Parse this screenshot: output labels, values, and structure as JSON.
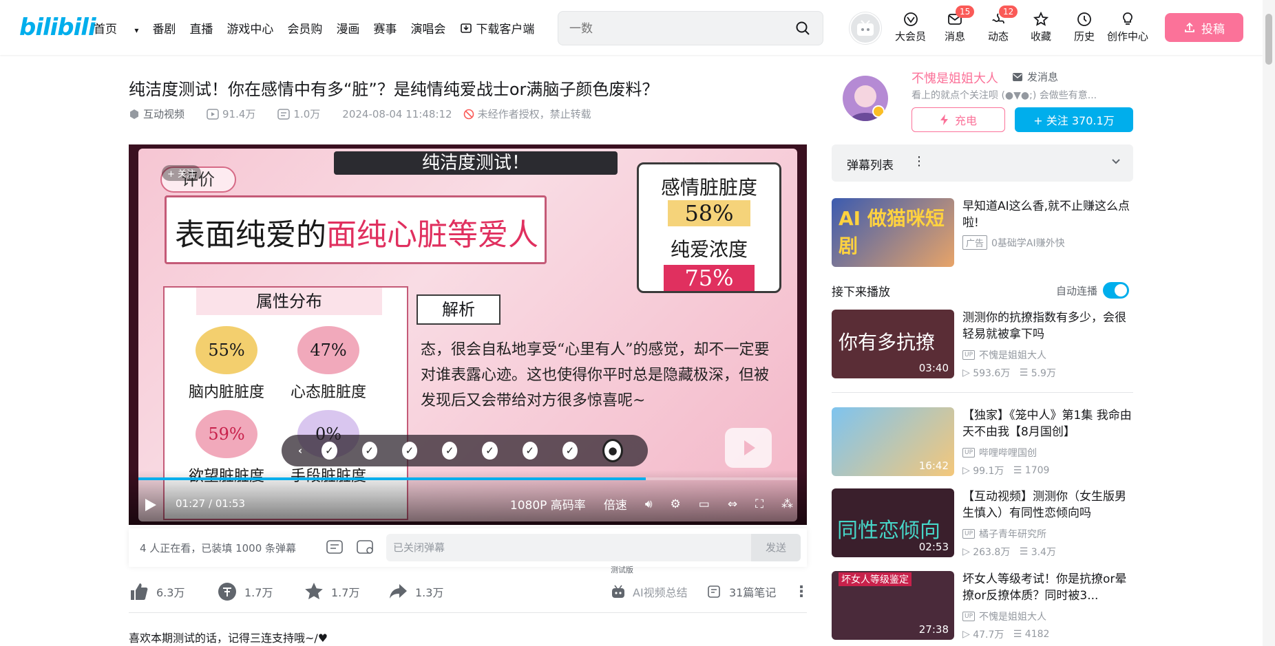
{
  "header": {
    "logo": "bilibili",
    "nav": [
      "首页",
      "番剧",
      "直播",
      "游戏中心",
      "会员购",
      "漫画",
      "赛事",
      "演唱会"
    ],
    "download": "下载客户端",
    "search_placeholder": "一数",
    "right_nav": [
      {
        "label": "大会员",
        "icon": "vip-icon",
        "badge": ""
      },
      {
        "label": "消息",
        "icon": "message-icon",
        "badge": "15"
      },
      {
        "label": "动态",
        "icon": "dynamic-icon",
        "badge": "12"
      },
      {
        "label": "收藏",
        "icon": "star-icon",
        "badge": ""
      },
      {
        "label": "历史",
        "icon": "history-icon",
        "badge": ""
      },
      {
        "label": "创作中心",
        "icon": "bulb-icon",
        "badge": ""
      }
    ],
    "upload": "投稿"
  },
  "video": {
    "title": "纯洁度测试！你在感情中有多“脏”？是纯情纯爱战士or满脑子颜色废料？",
    "category": "互动视频",
    "views": "91.4万",
    "danmaku_count": "1.0万",
    "date": "2024-08-04 11:48:12",
    "copyright": "未经作者授权，禁止转载"
  },
  "player": {
    "banner": "纯洁度测试！",
    "tag": "评价",
    "result": "表面纯爱的面纯心脏等爱人",
    "result_a": "表面纯爱的",
    "result_b": "面纯心脏等爱人",
    "emotion_label": "感情脏脏度",
    "emotion_value": "58%",
    "pure_label": "纯爱浓度",
    "pure_value": "75%",
    "attr_title": "属性分布",
    "stats": [
      {
        "pct": "55%",
        "name": "脑内脏脏度"
      },
      {
        "pct": "47%",
        "name": "心态脏脏度"
      },
      {
        "pct": "59%",
        "name": "欲望脏脏度"
      },
      {
        "pct": "0%",
        "name": "手段脏脏度"
      }
    ],
    "analysis_title": "解析",
    "analysis_text": "态，很会自私地享受“心里有人”的感觉，却不一定要对谁表露心迹。这也使得你平时总是隐藏极深，但被发现后又会带给对方很多惊喜呢~",
    "watermark": "不愧是姐姐大人",
    "follow": "+ 关注",
    "time_current": "01:27",
    "time_total": "01:53",
    "progress_fraction": 0.77,
    "quality": "1080P 高码率",
    "speed": "倍速"
  },
  "danmaku_bar": {
    "watching": "4 人正在看，已装填 1000 条弹幕",
    "input_placeholder": "已关闭弹幕",
    "send": "发送"
  },
  "toolbar": {
    "like": "6.3万",
    "coin": "1.7万",
    "fav": "1.7万",
    "share": "1.3万",
    "ai_tag": "测试版",
    "ai_summary": "AI视频总结",
    "notes": "31篇笔记"
  },
  "description": "喜欢本期测试的话，记得三连支持哦~/♥",
  "uploader": {
    "name": "不愧是姐姐大人",
    "message": "发消息",
    "sign": "看上的就点个关注呗 (●▼●;) 会做些有意...",
    "charge": "充电",
    "follow": "+ 关注 370.1万"
  },
  "sidebar": {
    "danmaku_list": "弹幕列表",
    "next_up": "接下来播放",
    "autoplay": "自动连播",
    "ad": {
      "title": "早知道AI这么香,就不止赚这么点啦!",
      "tag": "广告",
      "author": "0基础学AI赚外快",
      "thumb_text": "AI 做猫咪短剧"
    },
    "recommendations": [
      {
        "title": "测测你的抗撩指数有多少，会很轻易就被拿下吗",
        "author": "不愧是姐姐大人",
        "views": "593.6万",
        "danmaku": "5.9万",
        "duration": "03:40",
        "thumb_text": "你有多抗撩"
      },
      {
        "title": "【独家】《笼中人》第1集 我命由天不由我【8月国创】",
        "author": "哔哩哔哩国创",
        "views": "99.1万",
        "danmaku": "1709",
        "duration": "16:42",
        "thumb_text": ""
      },
      {
        "title": "【互动视频】测测你（女生版男生慎入）有同性恋倾向吗",
        "author": "橘子青年研究所",
        "views": "263.8万",
        "danmaku": "3.4万",
        "duration": "02:53",
        "thumb_text": "同性恋倾向"
      },
      {
        "title": "坏女人等级考试！你是抗撩or晕撩or反撩体质？同时被3...",
        "author": "不愧是姐姐大人",
        "views": "47.7万",
        "danmaku": "4182",
        "duration": "27:38",
        "thumb_text": "坏女人等级鉴定"
      }
    ]
  },
  "colors": {
    "accent": "#00aeec",
    "pink": "#fb7299",
    "badge": "#fa5a57"
  }
}
